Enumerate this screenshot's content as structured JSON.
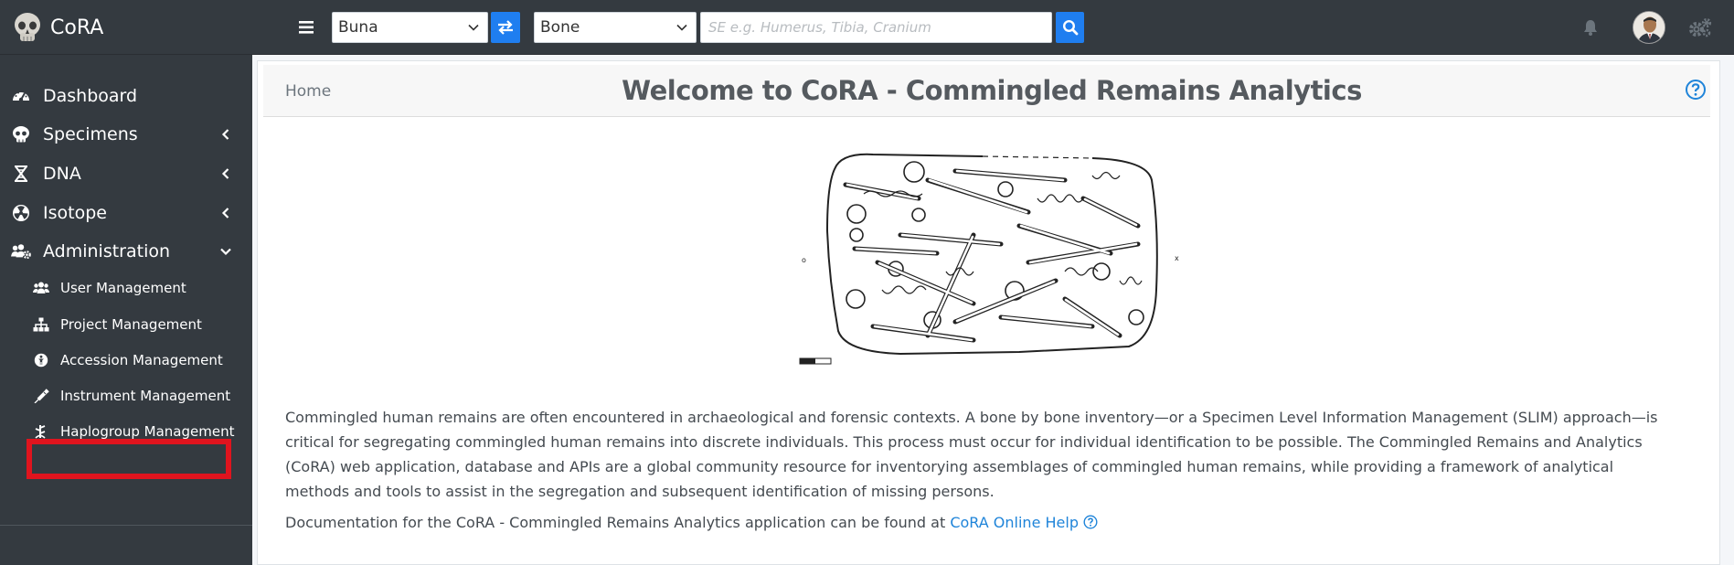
{
  "app": {
    "name": "CoRA"
  },
  "header": {
    "project_select": "Buna",
    "element_select": "Bone",
    "search": {
      "placeholder": "SE e.g. Humerus, Tibia, Cranium",
      "value": ""
    }
  },
  "sidebar": {
    "items": [
      {
        "label": "Dashboard",
        "icon": "dashboard-icon"
      },
      {
        "label": "Specimens",
        "icon": "skull-icon"
      },
      {
        "label": "DNA",
        "icon": "dna-icon"
      },
      {
        "label": "Isotope",
        "icon": "radiation-icon"
      },
      {
        "label": "Administration",
        "icon": "users-cog-icon"
      }
    ],
    "admin_items": [
      {
        "label": "User Management",
        "icon": "users-icon"
      },
      {
        "label": "Project Management",
        "icon": "sitemap-icon"
      },
      {
        "label": "Accession Management",
        "icon": "accession-icon"
      },
      {
        "label": "Instrument Management",
        "icon": "syringe-icon"
      },
      {
        "label": "Haplogroup Management",
        "icon": "haplogroup-icon"
      }
    ],
    "highlighted_item": "Instrument Management",
    "highlight_color": "#e0141e"
  },
  "main": {
    "breadcrumb": "Home",
    "title": "Welcome to CoRA - Commingled Remains Analytics",
    "paragraph": "Commingled human remains are often encountered in archaeological and forensic contexts. A bone by bone inventory—or a Specimen Level Information Management (SLIM) approach—is critical for segregating commingled human remains into discrete individuals. This process must occur for individual identification to be possible. The Commingled Remains and Analytics (CoRA) web application, database and APIs are a global community resource for inventorying assemblages of commingled human remains, while providing a framework of analytical methods and tools to assist in the segregation and subsequent identification of missing persons.",
    "doc_text": "Documentation for the CoRA - Commingled Remains Analytics application can be found at ",
    "doc_link": "CoRA Online Help"
  },
  "colors": {
    "topbar": "#343a40",
    "accent": "#1f7ef0",
    "link": "#1f84d9"
  }
}
